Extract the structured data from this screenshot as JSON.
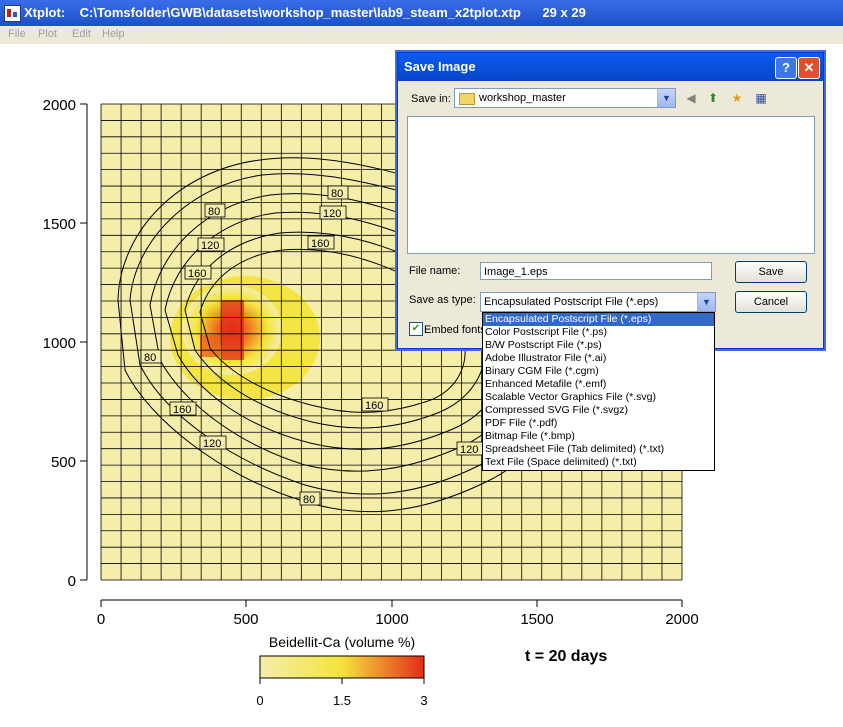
{
  "window": {
    "app": "Xtplot:",
    "path": "C:\\Tomsfolder\\GWB\\datasets\\workshop_master\\lab9_steam_x2tplot.xtp",
    "dims": "29 x 29"
  },
  "menu": [
    "File",
    "Plot",
    "Edit",
    "Help"
  ],
  "plot": {
    "y_ticks": [
      "2000",
      "1500",
      "1000",
      "500",
      "0"
    ],
    "x_ticks": [
      "0",
      "500",
      "1000",
      "1500",
      "2000"
    ],
    "contour_labels": [
      "80",
      "120",
      "160",
      "80",
      "120",
      "160",
      "80",
      "160",
      "160",
      "120",
      "120",
      "80"
    ],
    "colorbar_title": "Beidellit-Ca (volume %)",
    "colorbar_ticks": [
      "0",
      "1.5",
      "3"
    ],
    "time_label": "t = 20 days",
    "colors": {
      "low": "#f4eeaa",
      "mid": "#f4e33a",
      "high": "#e32d1a"
    }
  },
  "chart_data": {
    "type": "heatmap",
    "title": "",
    "xlabel": "",
    "ylabel": "",
    "xlim": [
      0,
      2000
    ],
    "ylim": [
      0,
      2000
    ],
    "grid_size": "29 x 29",
    "colorbar": {
      "label": "Beidellit-Ca (volume %)",
      "range": [
        0,
        3
      ]
    },
    "hotspot": {
      "x": 450,
      "y": 1020,
      "max_value": 3
    },
    "contour_levels": [
      80,
      120,
      160
    ],
    "annotation": "t = 20 days"
  },
  "dialog": {
    "title": "Save Image",
    "save_in_label": "Save in:",
    "save_in_value": "workshop_master",
    "file_name_label": "File name:",
    "file_name_value": "Image_1.eps",
    "save_as_type_label": "Save as type:",
    "save_as_type_value": "Encapsulated Postscript File (*.eps)",
    "embed_fonts_label": "Embed fonts",
    "save_button": "Save",
    "cancel_button": "Cancel",
    "help_button": "?",
    "close_button": "✕",
    "type_options": [
      "Encapsulated Postscript File (*.eps)",
      "Color Postscript File (*.ps)",
      "B/W Postscript File (*.ps)",
      "Adobe Illustrator File (*.ai)",
      "Binary CGM File (*.cgm)",
      "Enhanced Metafile (*.emf)",
      "Scalable Vector Graphics File (*.svg)",
      "Compressed SVG File (*.svgz)",
      "PDF File (*.pdf)",
      "Bitmap File (*.bmp)",
      "Spreadsheet File (Tab delimited) (*.txt)",
      "Text File (Space delimited) (*.txt)"
    ]
  }
}
